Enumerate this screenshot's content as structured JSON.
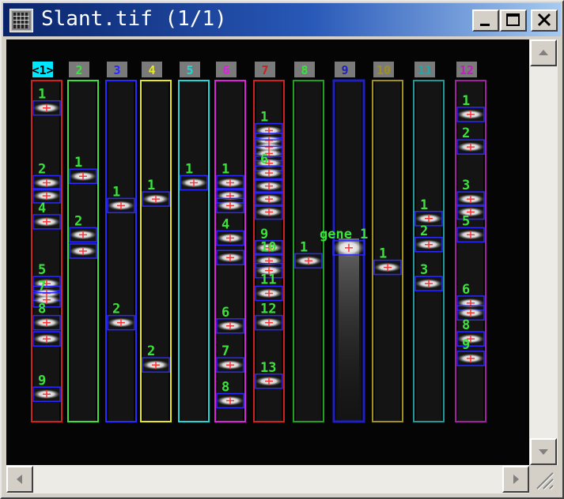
{
  "window": {
    "title": "Slant.tif (1/1)",
    "icon": "image-grid-icon",
    "controls": [
      "minimize-icon",
      "maximize-icon",
      "close-icon"
    ]
  },
  "colors": {
    "title_start": "#0a246a",
    "title_end": "#a6caf0",
    "band_label": "#3ce23c",
    "band_marker": "#ff3030",
    "band_box": "#2a2aff"
  },
  "lanes": [
    {
      "label": "<1>",
      "color": "#d02020",
      "tag_bg": "#00e8ff",
      "tag_fg": "#000000",
      "selected": true,
      "bands": [
        {
          "label": "1",
          "level": 0.06
        },
        {
          "label": "2",
          "level": 0.29
        },
        {
          "label": "",
          "level": 0.33
        },
        {
          "label": "4",
          "level": 0.41
        },
        {
          "label": "5",
          "level": 0.6
        },
        {
          "label": "",
          "level": 0.63
        },
        {
          "label": "7",
          "level": 0.65
        },
        {
          "label": "8",
          "level": 0.72
        },
        {
          "label": "",
          "level": 0.77
        },
        {
          "label": "9",
          "level": 0.94
        }
      ]
    },
    {
      "label": "2",
      "color": "#3ce23c",
      "tag_bg": "#7a7a7a",
      "tag_fg": "#3ce23c",
      "bands": [
        {
          "label": "1",
          "level": 0.27
        },
        {
          "label": "2",
          "level": 0.45
        },
        {
          "label": "",
          "level": 0.5
        }
      ]
    },
    {
      "label": "3",
      "color": "#2a2aff",
      "tag_bg": "#7a7a7a",
      "tag_fg": "#2a2aff",
      "bands": [
        {
          "label": "1",
          "level": 0.36
        },
        {
          "label": "2",
          "level": 0.72
        }
      ]
    },
    {
      "label": "4",
      "color": "#e8e820",
      "tag_bg": "#7a7a7a",
      "tag_fg": "#e8e820",
      "bands": [
        {
          "label": "1",
          "level": 0.34
        },
        {
          "label": "2",
          "level": 0.85
        }
      ]
    },
    {
      "label": "5",
      "color": "#20d8d8",
      "tag_bg": "#7a7a7a",
      "tag_fg": "#20d8d8",
      "bands": [
        {
          "label": "1",
          "level": 0.29
        }
      ]
    },
    {
      "label": "6",
      "color": "#e020e0",
      "tag_bg": "#7a7a7a",
      "tag_fg": "#e020e0",
      "bands": [
        {
          "label": "1",
          "level": 0.29
        },
        {
          "label": "",
          "level": 0.33
        },
        {
          "label": "",
          "level": 0.36
        },
        {
          "label": "4",
          "level": 0.46
        },
        {
          "label": "",
          "level": 0.52
        },
        {
          "label": "6",
          "level": 0.73
        },
        {
          "label": "7",
          "level": 0.85
        },
        {
          "label": "8",
          "level": 0.96
        }
      ]
    },
    {
      "label": "7",
      "color": "#d02020",
      "tag_bg": "#7a7a7a",
      "tag_fg": "#d02020",
      "bands": [
        {
          "label": "1",
          "level": 0.13
        },
        {
          "label": "",
          "level": 0.16
        },
        {
          "label": "",
          "level": 0.18
        },
        {
          "label": "",
          "level": 0.2
        },
        {
          "label": "",
          "level": 0.23
        },
        {
          "label": "6",
          "level": 0.26
        },
        {
          "label": "",
          "level": 0.3
        },
        {
          "label": "",
          "level": 0.34
        },
        {
          "label": "",
          "level": 0.38
        },
        {
          "label": "9",
          "level": 0.49
        },
        {
          "label": "10",
          "level": 0.53
        },
        {
          "label": "",
          "level": 0.56
        },
        {
          "label": "11",
          "level": 0.63
        },
        {
          "label": "12",
          "level": 0.72
        },
        {
          "label": "13",
          "level": 0.9
        }
      ]
    },
    {
      "label": "8",
      "color": "#20a020",
      "tag_bg": "#7a7a7a",
      "tag_fg": "#3ce23c",
      "bands": [
        {
          "label": "1",
          "level": 0.53
        }
      ]
    },
    {
      "label": "9",
      "color": "#2020c0",
      "tag_bg": "#7a7a7a",
      "tag_fg": "#2020c0",
      "wide": true,
      "bands": [
        {
          "label": "gene 1",
          "level": 0.49
        }
      ]
    },
    {
      "label": "10",
      "color": "#a09020",
      "tag_bg": "#7a7a7a",
      "tag_fg": "#a09020",
      "bands": [
        {
          "label": "1",
          "level": 0.55
        }
      ]
    },
    {
      "label": "11",
      "color": "#209898",
      "tag_bg": "#7a7a7a",
      "tag_fg": "#20a8a8",
      "bands": [
        {
          "label": "1",
          "level": 0.4
        },
        {
          "label": "2",
          "level": 0.48
        },
        {
          "label": "3",
          "level": 0.6
        }
      ]
    },
    {
      "label": "12",
      "color": "#a020a0",
      "tag_bg": "#7a7a7a",
      "tag_fg": "#c020c0",
      "bands": [
        {
          "label": "1",
          "level": 0.08
        },
        {
          "label": "2",
          "level": 0.18
        },
        {
          "label": "3",
          "level": 0.34
        },
        {
          "label": "",
          "level": 0.38
        },
        {
          "label": "5",
          "level": 0.45
        },
        {
          "label": "6",
          "level": 0.66
        },
        {
          "label": "",
          "level": 0.69
        },
        {
          "label": "8",
          "level": 0.77
        },
        {
          "label": "9",
          "level": 0.83
        }
      ]
    }
  ]
}
